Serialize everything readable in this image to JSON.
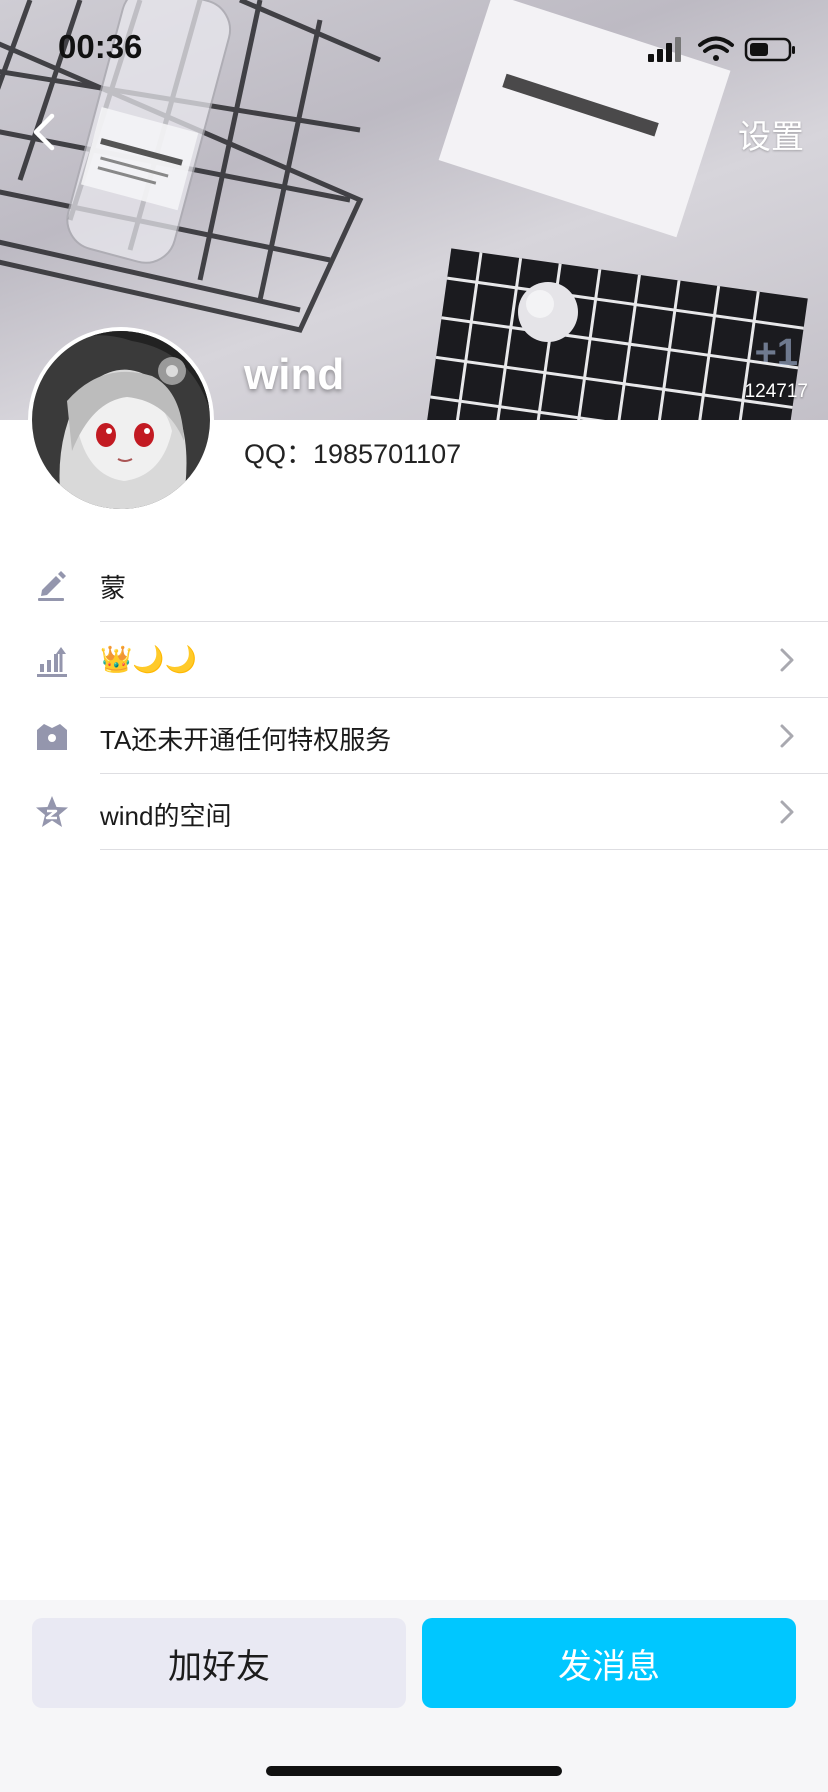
{
  "status_bar": {
    "time": "00:36"
  },
  "nav": {
    "back_icon": "chevron-left-icon",
    "settings_label": "设置"
  },
  "cover": {
    "like_count": "124717",
    "like_plus": "+1"
  },
  "profile": {
    "nickname": "wind",
    "qq_label": "QQ：1985701107"
  },
  "info_list": [
    {
      "icon": "pencil-icon",
      "label": "蒙",
      "has_chevron": false
    },
    {
      "icon": "level-up-icon",
      "label": "👑🌙🌙",
      "has_chevron": true
    },
    {
      "icon": "vip-crown-icon",
      "label": "TA还未开通任何特权服务",
      "has_chevron": true
    },
    {
      "icon": "qzone-star-icon",
      "label": "wind的空间",
      "has_chevron": true
    }
  ],
  "actions": {
    "add_friend_label": "加好友",
    "send_message_label": "发消息"
  },
  "colors": {
    "accent": "#00c7ff",
    "secondary_button": "#e9e9f3",
    "icon_gray": "#9496ad"
  }
}
